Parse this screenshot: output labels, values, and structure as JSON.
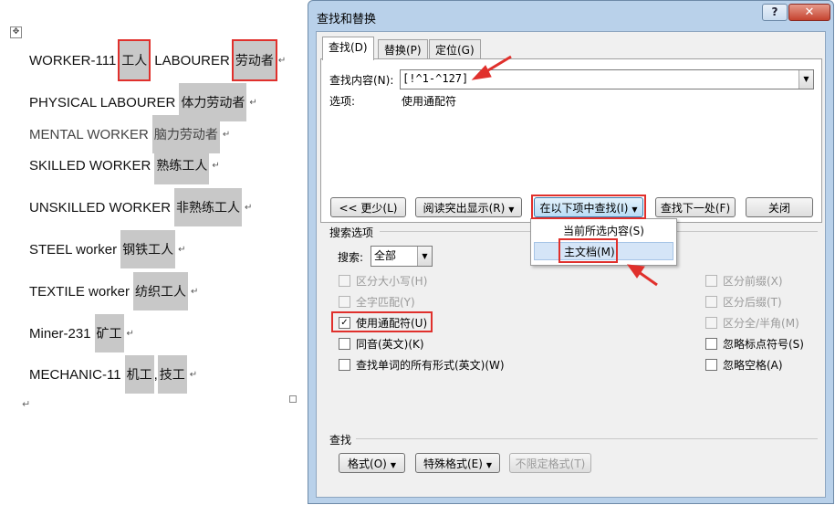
{
  "document": {
    "move_handle": "✥",
    "lines": [
      {
        "en": "WORKER-111",
        "cn": "工人",
        "en2": "LABOURER",
        "cn2": "劳动者"
      },
      {
        "en": "PHYSICAL LABOURER",
        "cn": "体力劳动者"
      },
      {
        "en": "MENTAL WORKER",
        "cn": "脑力劳动者"
      },
      {
        "en": "SKILLED WORKER",
        "cn": "熟练工人"
      },
      {
        "en": "UNSKILLED WORKER",
        "cn": "非熟练工人"
      },
      {
        "en": "STEEL worker",
        "cn": "钢铁工人"
      },
      {
        "en": "TEXTILE worker",
        "cn": "纺织工人"
      },
      {
        "en": "Miner-231",
        "cn": "矿工"
      },
      {
        "en": "MECHANIC-11",
        "cn": "机工",
        "cn2": "技工",
        "sep": ","
      }
    ],
    "paragraph_mark": "↵"
  },
  "dialog": {
    "title": "查找和替换",
    "help_label": "?",
    "close_label": "✕",
    "tabs": [
      {
        "label": "查找(D)",
        "active": true
      },
      {
        "label": "替换(P)",
        "active": false
      },
      {
        "label": "定位(G)",
        "active": false
      }
    ],
    "find_label": "查找内容(N):",
    "find_value": "[!^1-^127]",
    "options_label": "选项:",
    "options_value": "使用通配符",
    "buttons": {
      "less": "<< 更少(L)",
      "reading_highlight": "阅读突出显示(R)",
      "find_in": "在以下项中查找(I)",
      "find_next": "查找下一处(F)",
      "close": "关闭"
    },
    "find_in_menu": [
      "当前所选内容(S)",
      "主文档(M)"
    ],
    "search_options_title": "搜索选项",
    "search_label": "搜索:",
    "search_value": "全部",
    "left_options": [
      {
        "label": "区分大小写(H)",
        "checked": false,
        "enabled": false
      },
      {
        "label": "全字匹配(Y)",
        "checked": false,
        "enabled": false
      },
      {
        "label": "使用通配符(U)",
        "checked": true,
        "enabled": true
      },
      {
        "label": "同音(英文)(K)",
        "checked": false,
        "enabled": true
      },
      {
        "label": "查找单词的所有形式(英文)(W)",
        "checked": false,
        "enabled": true
      }
    ],
    "right_options": [
      {
        "label": "区分前缀(X)",
        "checked": false,
        "enabled": false
      },
      {
        "label": "区分后缀(T)",
        "checked": false,
        "enabled": false
      },
      {
        "label": "区分全/半角(M)",
        "checked": false,
        "enabled": false
      },
      {
        "label": "忽略标点符号(S)",
        "checked": false,
        "enabled": true
      },
      {
        "label": "忽略空格(A)",
        "checked": false,
        "enabled": true
      }
    ],
    "find_section_title": "查找",
    "format_buttons": {
      "format": "格式(O)",
      "special": "特殊格式(E)",
      "no_format": "不限定格式(T)"
    },
    "checkmark": "✓",
    "dropdown_glyph": "▼"
  },
  "colors": {
    "highlight_red": "#e0302c",
    "dialog_frame": "#b9d1ea",
    "doc_shade": "#c8c8c8"
  }
}
